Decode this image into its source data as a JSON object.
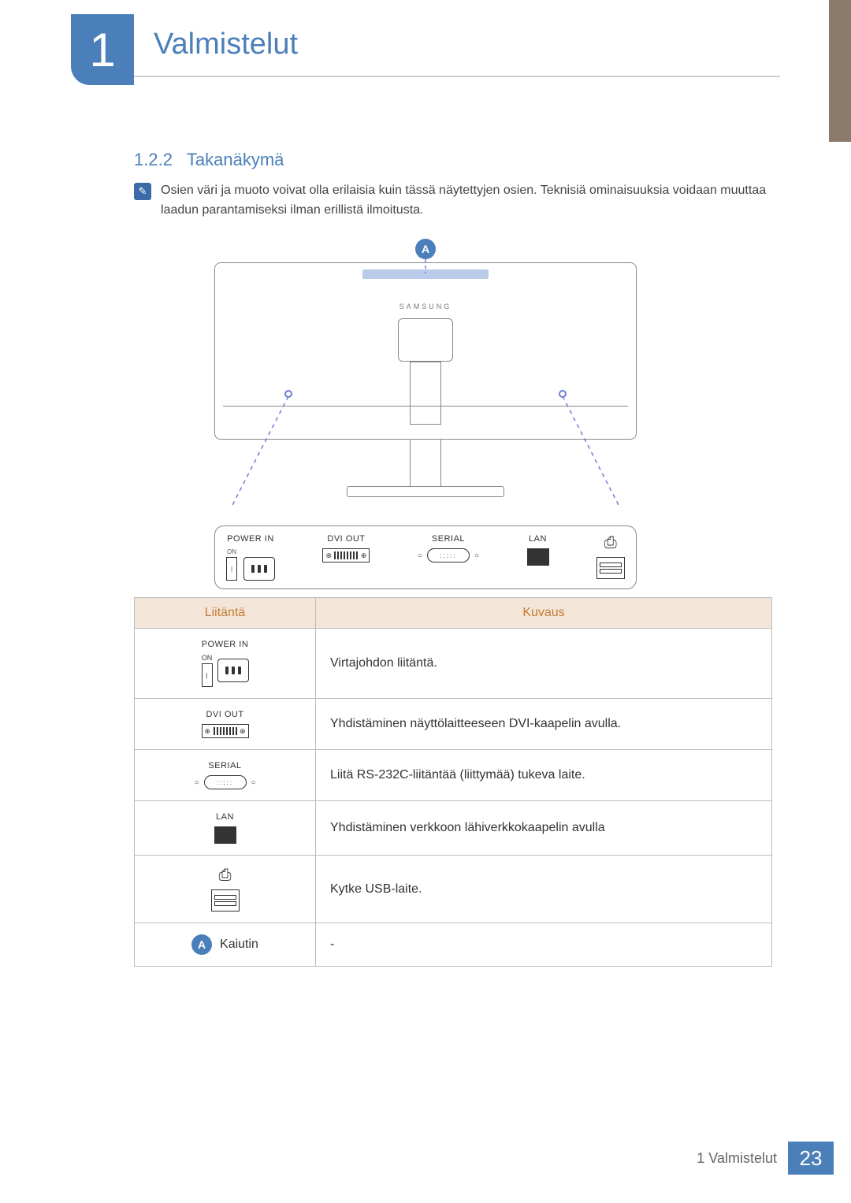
{
  "chapter": {
    "number": "1",
    "title": "Valmistelut"
  },
  "section": {
    "number": "1.2.2",
    "title": "Takanäkymä"
  },
  "note_text": "Osien väri ja muoto voivat olla erilaisia kuin tässä näytettyjen osien. Teknisiä ominaisuuksia voidaan muuttaa laadun parantamiseksi ilman erillistä ilmoitusta.",
  "diagram": {
    "callout_letter": "A",
    "brand": "SAMSUNG",
    "panel_labels": {
      "power_in": "POWER IN",
      "on": "ON",
      "dvi_out": "DVI OUT",
      "serial": "SERIAL",
      "lan": "LAN",
      "usb_symbol": "⬠"
    }
  },
  "table": {
    "headers": {
      "port": "Liitäntä",
      "desc": "Kuvaus"
    },
    "rows": [
      {
        "label": "POWER IN",
        "sublabel": "ON",
        "desc": "Virtajohdon liitäntä."
      },
      {
        "label": "DVI OUT",
        "desc": "Yhdistäminen näyttölaitteeseen DVI-kaapelin avulla."
      },
      {
        "label": "SERIAL",
        "desc": "Liitä RS-232C-liitäntää (liittymää) tukeva laite."
      },
      {
        "label": "LAN",
        "desc": "Yhdistäminen verkkoon lähiverkkokaapelin avulla"
      },
      {
        "label_symbol": "USB",
        "desc": "Kytke USB-laite."
      },
      {
        "callout": "A",
        "callout_text": "Kaiutin",
        "desc": "-"
      }
    ]
  },
  "footer": {
    "breadcrumb": "1 Valmistelut",
    "page": "23"
  }
}
